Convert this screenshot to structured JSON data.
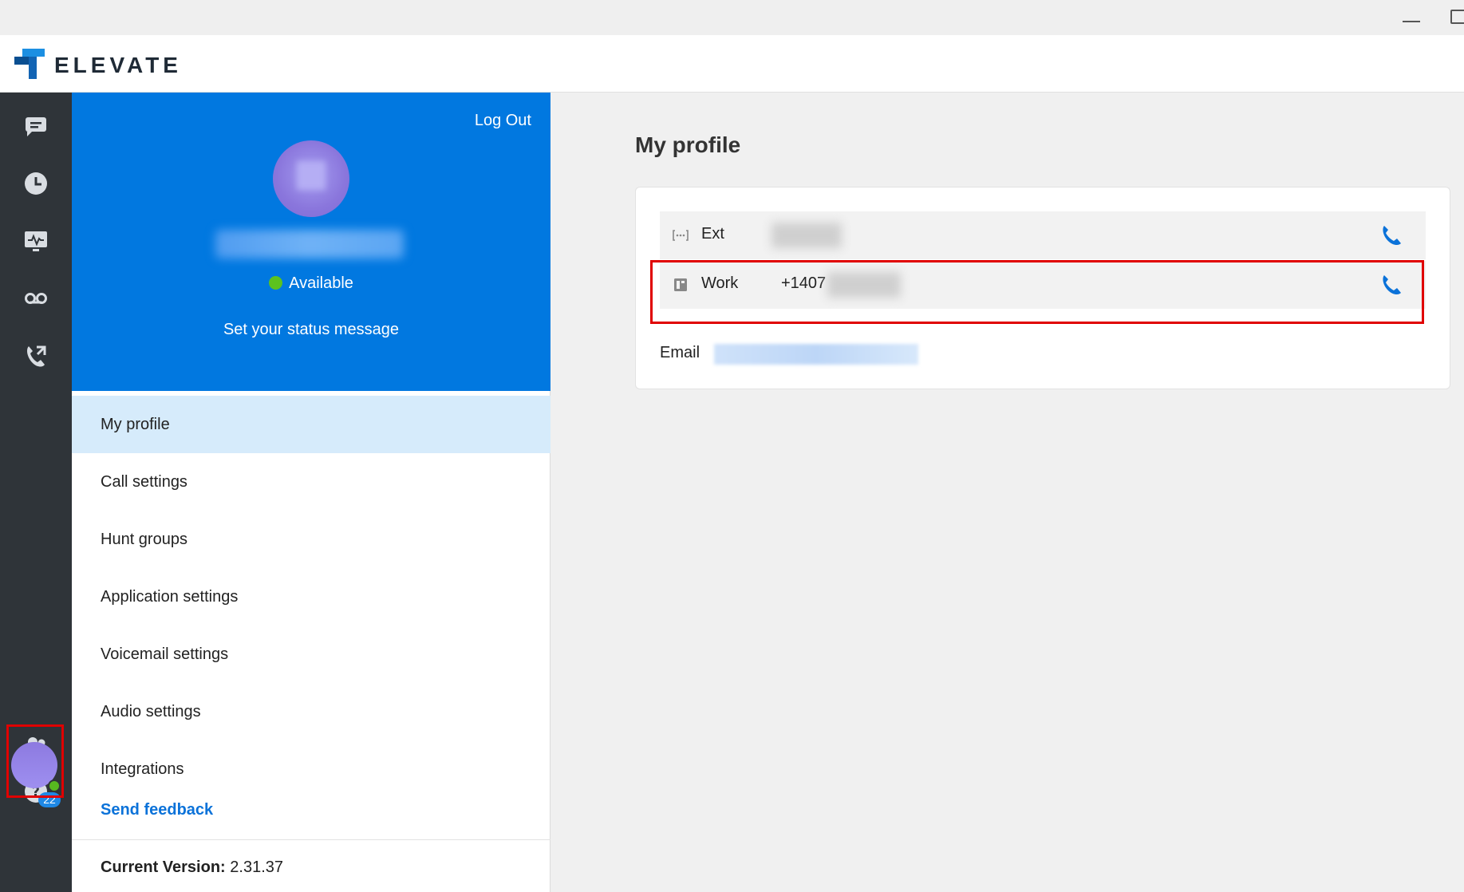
{
  "app": {
    "brand": "ELEVATE",
    "colors": {
      "accent": "#0178e0",
      "rail": "#2f3439",
      "presence": "#5cc21f",
      "highlight": "#e00000"
    }
  },
  "rail": {
    "items": [
      {
        "name": "messages-icon"
      },
      {
        "name": "history-clock-icon"
      },
      {
        "name": "activity-monitor-icon"
      },
      {
        "name": "voicemail-icon"
      },
      {
        "name": "call-forward-icon"
      },
      {
        "name": "contacts-icon"
      },
      {
        "name": "help-icon"
      }
    ],
    "help_badge": "22"
  },
  "profile_panel": {
    "logout_label": "Log Out",
    "status_label": "Available",
    "status_message_prompt": "Set your status message"
  },
  "menu": {
    "items": [
      {
        "label": "My profile",
        "active": true
      },
      {
        "label": "Call settings"
      },
      {
        "label": "Hunt groups"
      },
      {
        "label": "Application settings"
      },
      {
        "label": "Voicemail settings"
      },
      {
        "label": "Audio settings"
      },
      {
        "label": "Integrations"
      }
    ],
    "feedback_label": "Send feedback",
    "version_label": "Current Version:",
    "version_value": "2.31.37"
  },
  "main": {
    "title": "My profile",
    "rows": [
      {
        "label": "Ext",
        "value": ""
      },
      {
        "label": "Work",
        "value": "+1407"
      }
    ],
    "email_label": "Email"
  }
}
